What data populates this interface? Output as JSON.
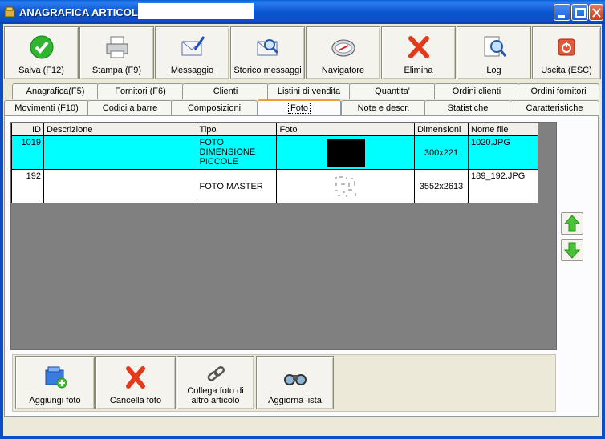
{
  "window": {
    "title": "ANAGRAFICA ARTICOLI -"
  },
  "toolbar": [
    {
      "label": "Salva (F12)",
      "icon": "check-icon"
    },
    {
      "label": "Stampa (F9)",
      "icon": "printer-icon"
    },
    {
      "label": "Messaggio",
      "icon": "message-icon"
    },
    {
      "label": "Storico messaggi",
      "icon": "message-history-icon"
    },
    {
      "label": "Navigatore",
      "icon": "compass-icon"
    },
    {
      "label": "Elimina",
      "icon": "delete-icon"
    },
    {
      "label": "Log",
      "icon": "log-icon"
    },
    {
      "label": "Uscita (ESC)",
      "icon": "exit-icon"
    }
  ],
  "tabs_top": [
    "Anagrafica(F5)",
    "Fornitori (F6)",
    "Clienti",
    "Listini di vendita",
    "Quantita'",
    "Ordini clienti",
    "Ordini fornitori"
  ],
  "tabs_bottom": [
    "Movimenti (F10)",
    "Codici a barre",
    "Composizioni",
    "Foto",
    "Note e descr.",
    "Statistiche",
    "Caratteristiche"
  ],
  "active_tab": "Foto",
  "grid": {
    "headers": [
      "ID",
      "Descrizione",
      "Tipo",
      "Foto",
      "Dimensioni",
      "Nome file"
    ],
    "rows": [
      {
        "id": "1019",
        "descrizione": "",
        "tipo": "FOTO DIMENSIONE PICCOLE",
        "dimensioni": "300x221",
        "nome_file": "1020.JPG",
        "selected": true
      },
      {
        "id": "192",
        "descrizione": "",
        "tipo": "FOTO MASTER",
        "dimensioni": "3552x2613",
        "nome_file": "189_192.JPG",
        "selected": false
      }
    ]
  },
  "actions": [
    {
      "label": "Aggiungi foto",
      "icon": "add-photo-icon"
    },
    {
      "label": "Cancella foto",
      "icon": "delete-icon"
    },
    {
      "label": "Collega foto di altro articolo",
      "icon": "link-icon"
    },
    {
      "label": "Aggiorna lista",
      "icon": "binoculars-icon"
    }
  ],
  "colors": {
    "selected_row": "#00ffff",
    "title_bar": "#0a56d1"
  }
}
